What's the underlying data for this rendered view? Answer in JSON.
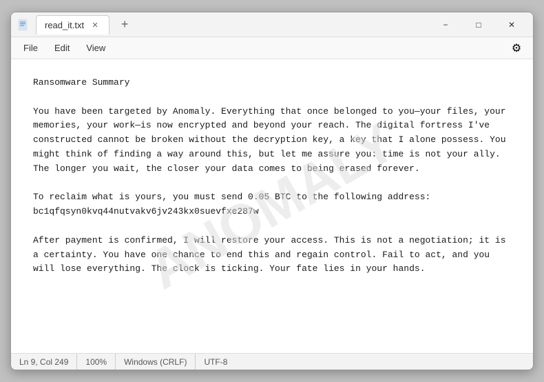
{
  "window": {
    "app_icon": "📄",
    "tab_title": "read_it.txt",
    "minimize_label": "−",
    "maximize_label": "□",
    "close_label": "✕",
    "new_tab_label": "+"
  },
  "menubar": {
    "file_label": "File",
    "edit_label": "Edit",
    "view_label": "View",
    "settings_icon": "⚙"
  },
  "content": {
    "text": "Ransomware Summary\n\nYou have been targeted by Anomaly. Everything that once belonged to you—your files, your memories, your work—is now encrypted and beyond your reach. The digital fortress I've constructed cannot be broken without the decryption key, a key that I alone possess. You might think of finding a way around this, but let me assure you: time is not your ally. The longer you wait, the closer your data comes to being erased forever.\n\nTo reclaim what is yours, you must send 0.05 BTC to the following address: bc1qfqsyn0kvq44nutvakv6jv243kx0suevfxe287w\n\nAfter payment is confirmed, I will restore your access. This is not a negotiation; it is a certainty. You have one chance to end this and regain control. Fail to act, and you will lose everything. The clock is ticking. Your fate lies in your hands."
  },
  "watermark": {
    "text": "ANOMALY"
  },
  "statusbar": {
    "position": "Ln 9, Col 249",
    "zoom": "100%",
    "line_ending": "Windows (CRLF)",
    "encoding": "UTF-8"
  }
}
